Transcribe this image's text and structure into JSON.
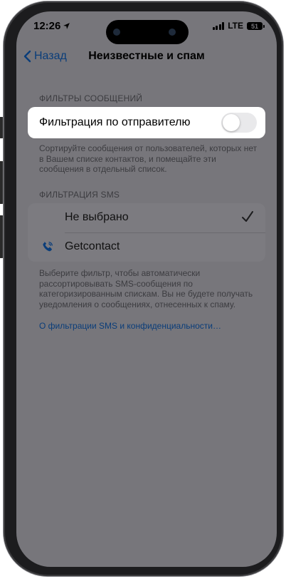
{
  "status_bar": {
    "time": "12:26",
    "network": "LTE",
    "battery": "51"
  },
  "nav": {
    "back_label": "Назад",
    "title": "Неизвестные и спам"
  },
  "message_filters": {
    "header": "ФИЛЬТРЫ СООБЩЕНИЙ",
    "sender_filter_label": "Фильтрация по отправителю",
    "sender_filter_on": false,
    "footnote": "Сортируйте сообщения от пользователей, которых нет в Вашем списке контактов, и помещайте эти сообщения в отдельный список."
  },
  "sms_filtering": {
    "header": "ФИЛЬТРАЦИЯ SMS",
    "options": [
      {
        "label": "Не выбрано",
        "selected": true
      },
      {
        "label": "Getcontact",
        "selected": false,
        "icon": "phone-icon"
      }
    ],
    "footnote": "Выберите фильтр, чтобы автоматически рассортировывать SMS-сообщения по категоризированным спискам. Вы не будете получать уведомления о сообщениях, отнесенных к спаму.",
    "privacy_link": "О фильтрации SMS и конфиденциальности…"
  },
  "colors": {
    "dim_overlay": "#77767b",
    "link": "#0a3d7a",
    "highlight_row": "#ffffff"
  }
}
